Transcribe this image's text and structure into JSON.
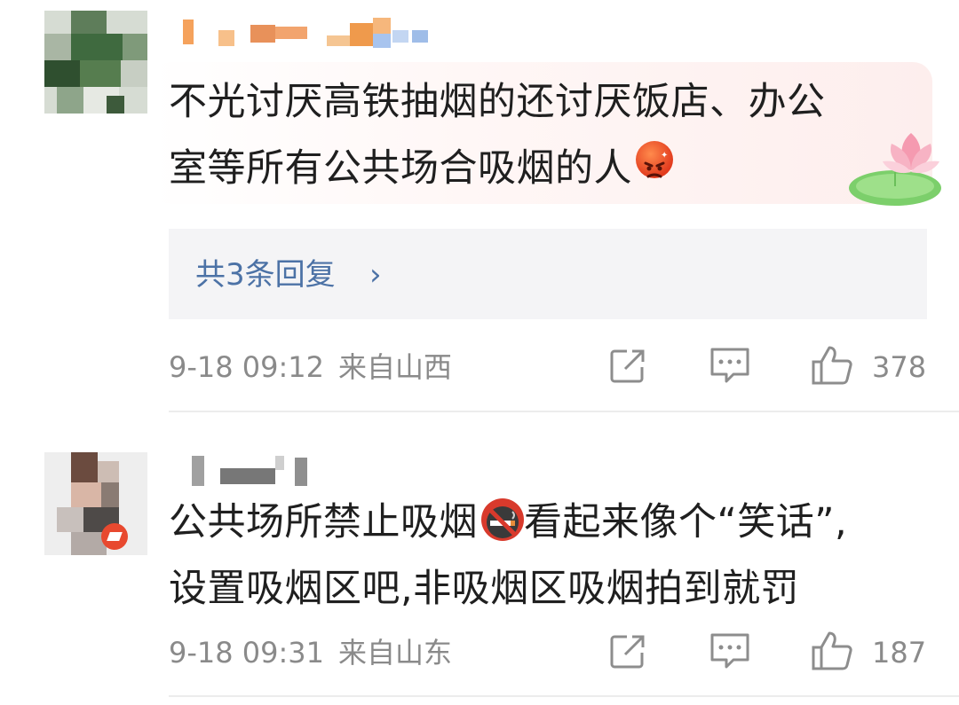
{
  "comments": [
    {
      "text_line1": "不光讨厌高铁抽烟的还讨厌饭店、办公",
      "text_line2": "室等所有公共场合吸烟的人",
      "emoji": "angry-face-emoji",
      "replies_label": "共3条回复",
      "replies_chevron": "›",
      "time": "9-18 09:12",
      "location": "来自山西",
      "likes": "378",
      "icons": [
        "share-icon",
        "comment-icon",
        "like-icon"
      ]
    },
    {
      "text_line1_a": "公共场所禁止吸烟",
      "text_line1_b": "看起来像个“笑话”,",
      "text_line2": "设置吸烟区吧,非吸烟区吸烟拍到就罚",
      "emoji": "no-smoking-emoji",
      "time": "9-18 09:31",
      "location": "来自山东",
      "likes": "187",
      "icons": [
        "share-icon",
        "comment-icon",
        "like-icon"
      ]
    }
  ],
  "colors": {
    "link": "#4c72a6",
    "meta": "#8a8a8a",
    "reply_bg": "#f4f4f6"
  }
}
